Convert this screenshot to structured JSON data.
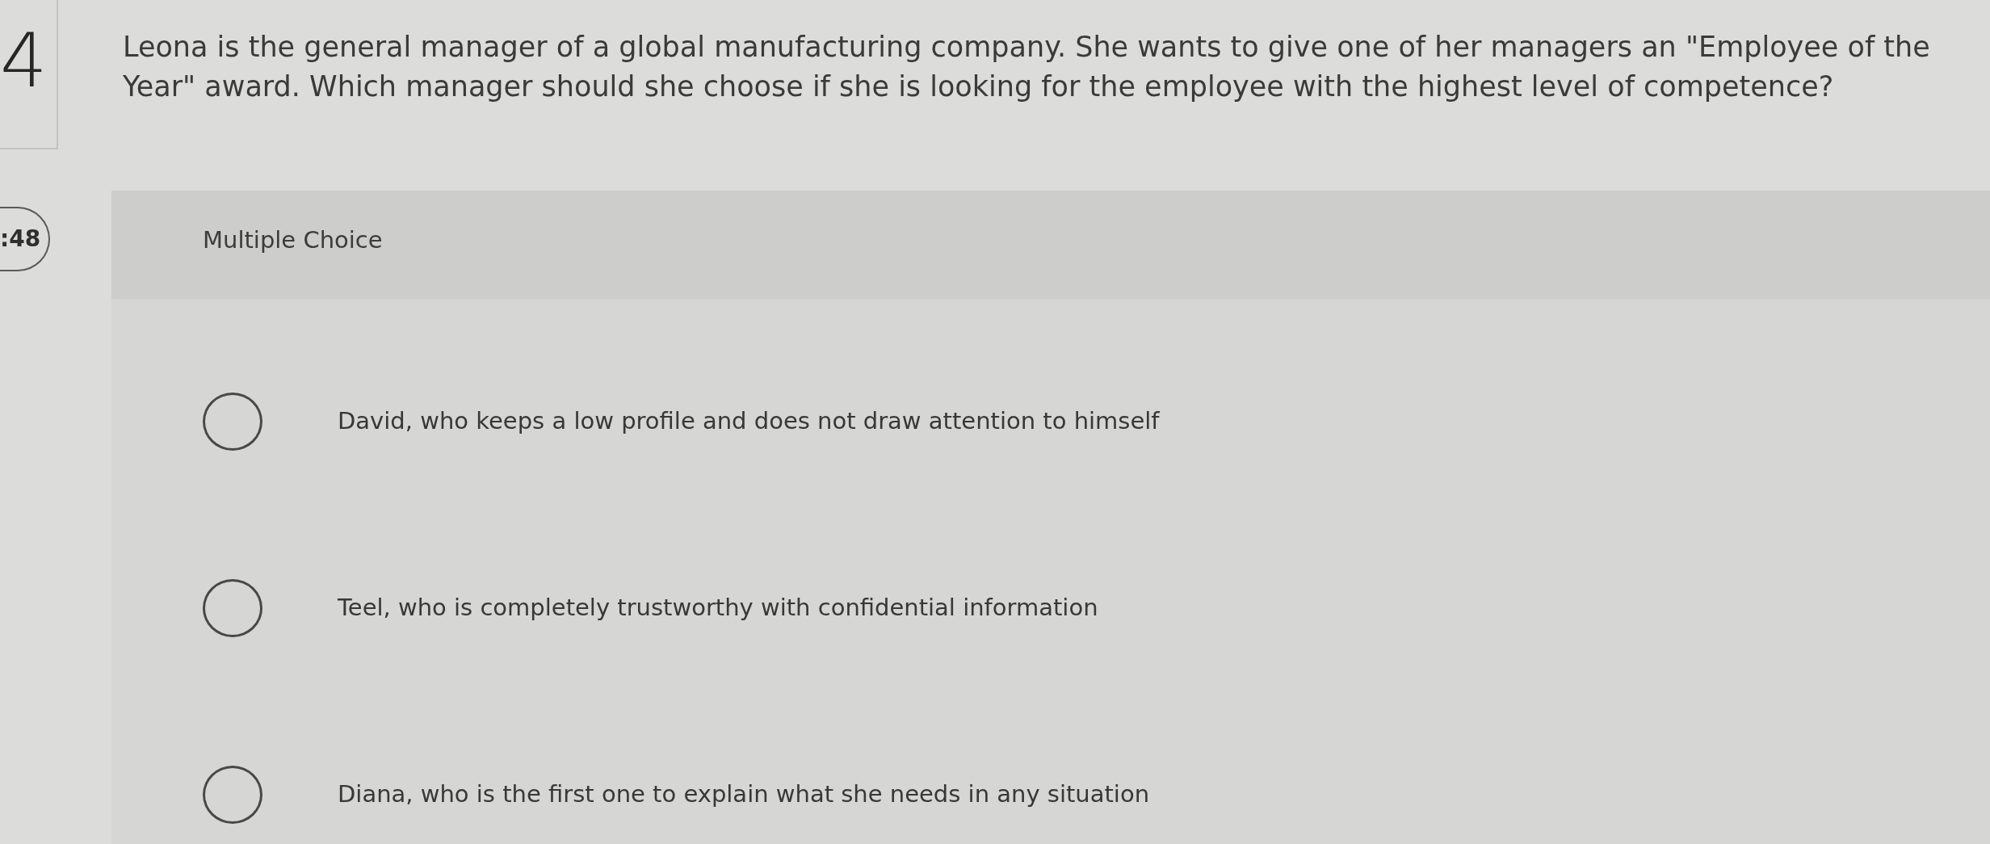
{
  "question_number": "4",
  "timer": ":48",
  "question": "Leona is the general manager of a global manufacturing company. She wants to give one of her managers an \"Employee of the Year\" award. Which manager should she choose if she is looking for the employee with the highest level of competence?",
  "panel": {
    "title": "Multiple Choice",
    "options": [
      {
        "label": "David, who keeps a low profile and does not draw attention to himself",
        "selected": false
      },
      {
        "label": "Teel, who is completely trustworthy with confidential information",
        "selected": false
      },
      {
        "label": "Diana, who is the first one to explain what she needs in any situation",
        "selected": false
      }
    ]
  }
}
